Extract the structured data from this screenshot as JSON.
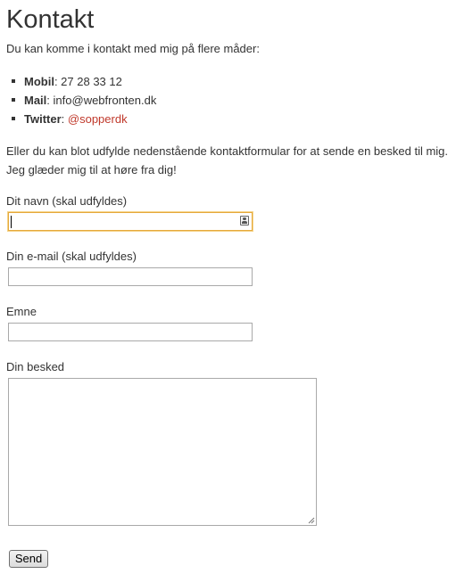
{
  "page": {
    "title": "Kontakt",
    "intro": "Du kan komme i kontakt med mig på flere måder:",
    "contacts": [
      {
        "label": "Mobil",
        "separator": ": ",
        "value": "27 28 33 12"
      },
      {
        "label": "Mail",
        "separator": ": ",
        "value": "info@webfronten.dk"
      },
      {
        "label": "Twitter",
        "separator": ": ",
        "value": "@sopperdk"
      }
    ],
    "note_line1": "Eller du kan blot udfylde nedenstående kontaktformular for at sende en besked til mig.",
    "note_line2": "Jeg glæder mig til at høre fra dig!"
  },
  "form": {
    "name_label": "Dit navn (skal udfyldes)",
    "name_value": "",
    "email_label": "Din e-mail (skal udfyldes)",
    "email_value": "",
    "subject_label": "Emne",
    "subject_value": "",
    "message_label": "Din besked",
    "message_value": "",
    "submit_label": "Send"
  },
  "colors": {
    "text": "#333333",
    "link": "#c0392b",
    "focus_border": "#e5a93c"
  },
  "icons": {
    "autofill": "contact-card-icon",
    "resize": "resize-grip-icon"
  }
}
